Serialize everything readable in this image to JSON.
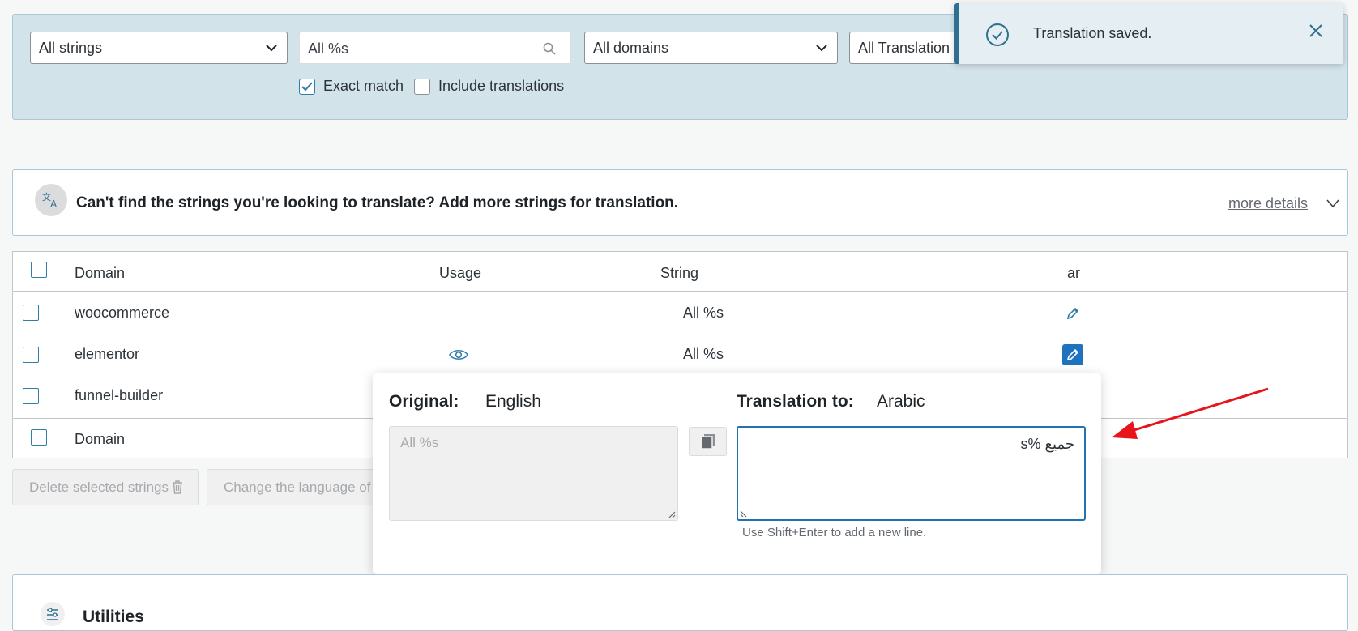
{
  "filters": {
    "strings_select": "All strings",
    "search_value": "All %s",
    "domains_select": "All domains",
    "translation_select": "All Translation P",
    "exact_match_label": "Exact match",
    "exact_match_checked": true,
    "include_translations_label": "Include translations",
    "include_translations_checked": false
  },
  "toast": {
    "message": "Translation saved."
  },
  "notice": {
    "text": "Can't find the strings you're looking to translate? Add more strings for translation.",
    "more_details": "more details"
  },
  "table": {
    "headers": {
      "domain": "Domain",
      "usage": "Usage",
      "string": "String",
      "language": "ar"
    },
    "rows": [
      {
        "domain": "woocommerce",
        "string": "All %s",
        "has_usage_icon": false
      },
      {
        "domain": "elementor",
        "string": "All %s",
        "has_usage_icon": true
      },
      {
        "domain": "funnel-builder",
        "string": "",
        "has_usage_icon": false
      }
    ],
    "footer_domain": "Domain"
  },
  "actions": {
    "delete_selected": "Delete selected strings",
    "change_language": "Change the language of s"
  },
  "popup": {
    "original_label": "Original:",
    "original_language": "English",
    "translation_label": "Translation to:",
    "translation_language": "Arabic",
    "original_value": "All %s",
    "translation_value": "جميع %s",
    "hint": "Use Shift+Enter to add a new line."
  },
  "utilities": {
    "title": "Utilities"
  },
  "colors": {
    "accent": "#1e73be",
    "panel_bg": "#d3e3ea",
    "arrow": "#e8141b"
  }
}
